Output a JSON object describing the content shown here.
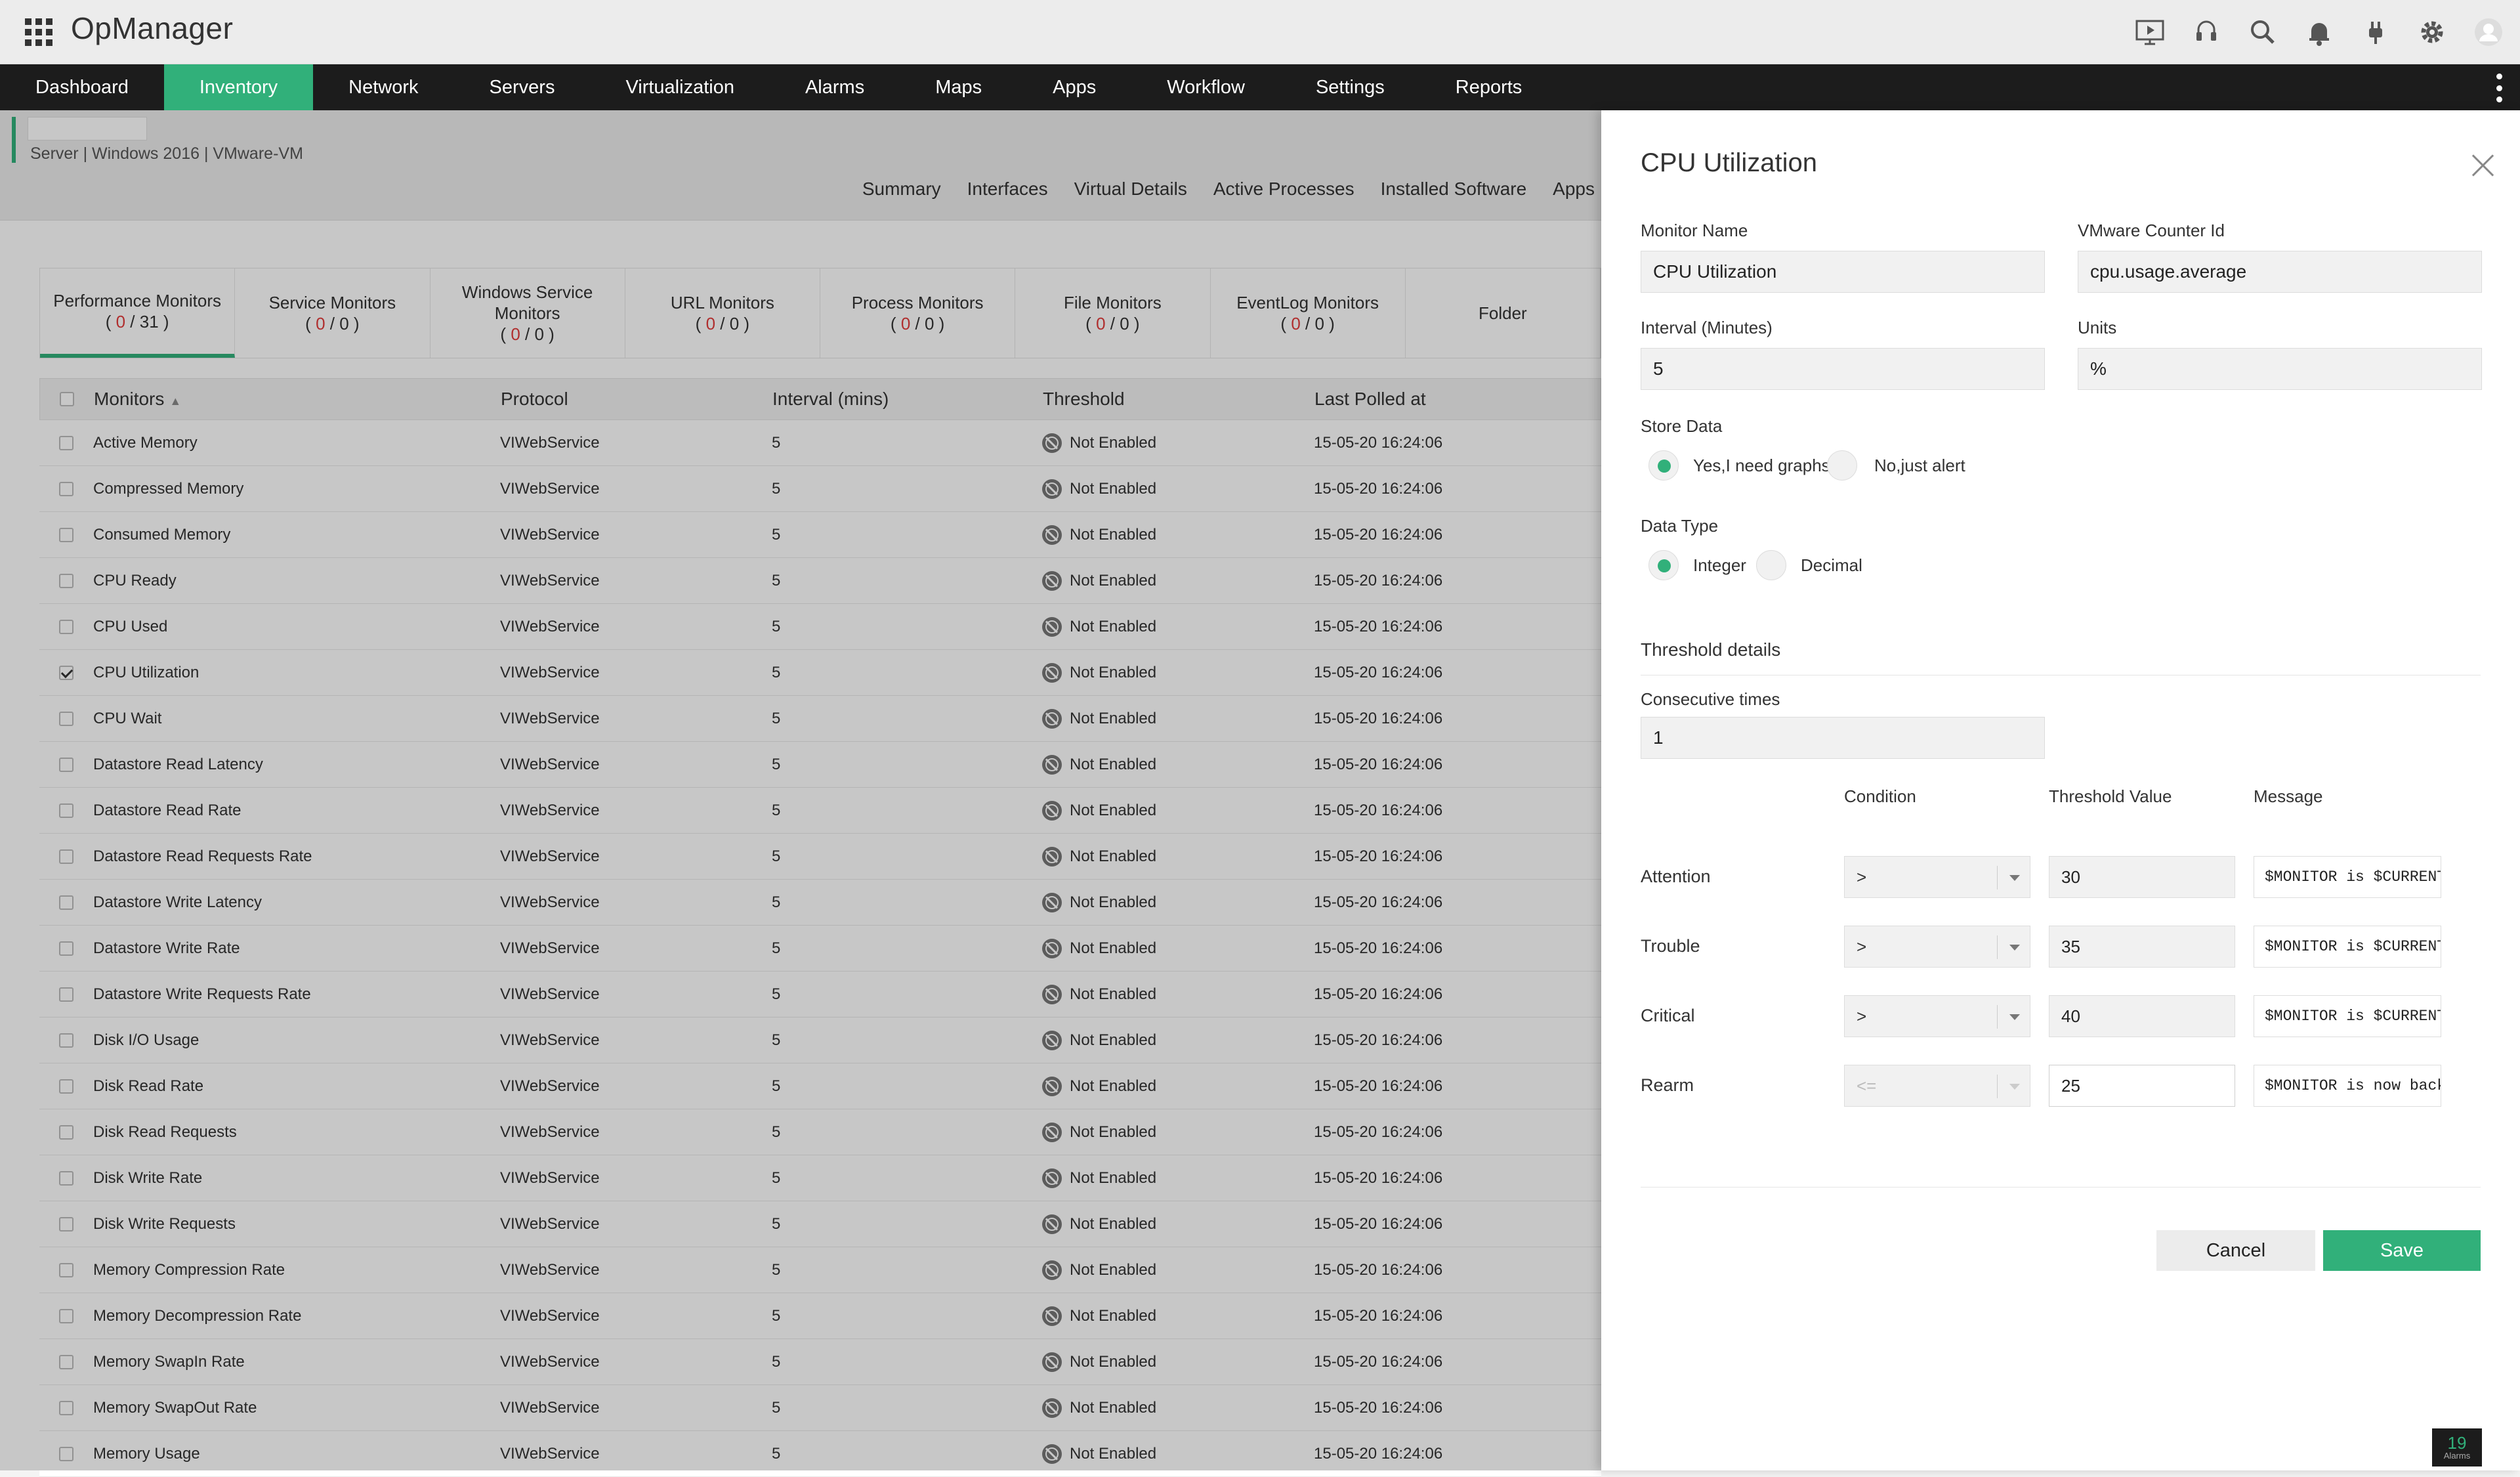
{
  "header": {
    "brand": "OpManager",
    "icons": [
      "presentation-icon",
      "support-headset-icon",
      "search-icon",
      "notification-bell-icon",
      "plug-icon",
      "settings-gear-icon",
      "user-avatar-icon"
    ]
  },
  "nav": {
    "items": [
      "Dashboard",
      "Inventory",
      "Network",
      "Servers",
      "Virtualization",
      "Alarms",
      "Maps",
      "Apps",
      "Workflow",
      "Settings",
      "Reports"
    ],
    "active": "Inventory"
  },
  "device": {
    "meta": "Server | Windows 2016  | VMware-VM",
    "tabs": [
      "Summary",
      "Interfaces",
      "Virtual Details",
      "Active Processes",
      "Installed Software",
      "Apps"
    ]
  },
  "monitor_tabs": [
    {
      "label": "Performance Monitors",
      "a": "0",
      "b": "31"
    },
    {
      "label": "Service Monitors",
      "a": "0",
      "b": "0"
    },
    {
      "label": "Windows Service Monitors",
      "a": "0",
      "b": "0"
    },
    {
      "label": "URL Monitors",
      "a": "0",
      "b": "0"
    },
    {
      "label": "Process Monitors",
      "a": "0",
      "b": "0"
    },
    {
      "label": "File Monitors",
      "a": "0",
      "b": "0"
    },
    {
      "label": "EventLog Monitors",
      "a": "0",
      "b": "0"
    },
    {
      "label": "Folder",
      "a": "",
      "b": ""
    }
  ],
  "table": {
    "columns": [
      "Monitors",
      "Protocol",
      "Interval (mins)",
      "Threshold",
      "Last Polled at"
    ],
    "rows": [
      {
        "name": "Active Memory",
        "protocol": "VIWebService",
        "interval": "5",
        "threshold": "Not Enabled",
        "last": "15-05-20 16:24:06",
        "checked": false
      },
      {
        "name": "Compressed Memory",
        "protocol": "VIWebService",
        "interval": "5",
        "threshold": "Not Enabled",
        "last": "15-05-20 16:24:06",
        "checked": false
      },
      {
        "name": "Consumed Memory",
        "protocol": "VIWebService",
        "interval": "5",
        "threshold": "Not Enabled",
        "last": "15-05-20 16:24:06",
        "checked": false
      },
      {
        "name": "CPU Ready",
        "protocol": "VIWebService",
        "interval": "5",
        "threshold": "Not Enabled",
        "last": "15-05-20 16:24:06",
        "checked": false
      },
      {
        "name": "CPU Used",
        "protocol": "VIWebService",
        "interval": "5",
        "threshold": "Not Enabled",
        "last": "15-05-20 16:24:06",
        "checked": false
      },
      {
        "name": "CPU Utilization",
        "protocol": "VIWebService",
        "interval": "5",
        "threshold": "Not Enabled",
        "last": "15-05-20 16:24:06",
        "checked": true
      },
      {
        "name": "CPU Wait",
        "protocol": "VIWebService",
        "interval": "5",
        "threshold": "Not Enabled",
        "last": "15-05-20 16:24:06",
        "checked": false
      },
      {
        "name": "Datastore Read Latency",
        "protocol": "VIWebService",
        "interval": "5",
        "threshold": "Not Enabled",
        "last": "15-05-20 16:24:06",
        "checked": false
      },
      {
        "name": "Datastore Read Rate",
        "protocol": "VIWebService",
        "interval": "5",
        "threshold": "Not Enabled",
        "last": "15-05-20 16:24:06",
        "checked": false
      },
      {
        "name": "Datastore Read Requests Rate",
        "protocol": "VIWebService",
        "interval": "5",
        "threshold": "Not Enabled",
        "last": "15-05-20 16:24:06",
        "checked": false
      },
      {
        "name": "Datastore Write Latency",
        "protocol": "VIWebService",
        "interval": "5",
        "threshold": "Not Enabled",
        "last": "15-05-20 16:24:06",
        "checked": false
      },
      {
        "name": "Datastore Write Rate",
        "protocol": "VIWebService",
        "interval": "5",
        "threshold": "Not Enabled",
        "last": "15-05-20 16:24:06",
        "checked": false
      },
      {
        "name": "Datastore Write Requests Rate",
        "protocol": "VIWebService",
        "interval": "5",
        "threshold": "Not Enabled",
        "last": "15-05-20 16:24:06",
        "checked": false
      },
      {
        "name": "Disk I/O Usage",
        "protocol": "VIWebService",
        "interval": "5",
        "threshold": "Not Enabled",
        "last": "15-05-20 16:24:06",
        "checked": false
      },
      {
        "name": "Disk Read Rate",
        "protocol": "VIWebService",
        "interval": "5",
        "threshold": "Not Enabled",
        "last": "15-05-20 16:24:06",
        "checked": false
      },
      {
        "name": "Disk Read Requests",
        "protocol": "VIWebService",
        "interval": "5",
        "threshold": "Not Enabled",
        "last": "15-05-20 16:24:06",
        "checked": false
      },
      {
        "name": "Disk Write Rate",
        "protocol": "VIWebService",
        "interval": "5",
        "threshold": "Not Enabled",
        "last": "15-05-20 16:24:06",
        "checked": false
      },
      {
        "name": "Disk Write Requests",
        "protocol": "VIWebService",
        "interval": "5",
        "threshold": "Not Enabled",
        "last": "15-05-20 16:24:06",
        "checked": false
      },
      {
        "name": "Memory Compression Rate",
        "protocol": "VIWebService",
        "interval": "5",
        "threshold": "Not Enabled",
        "last": "15-05-20 16:24:06",
        "checked": false
      },
      {
        "name": "Memory Decompression Rate",
        "protocol": "VIWebService",
        "interval": "5",
        "threshold": "Not Enabled",
        "last": "15-05-20 16:24:06",
        "checked": false
      },
      {
        "name": "Memory SwapIn Rate",
        "protocol": "VIWebService",
        "interval": "5",
        "threshold": "Not Enabled",
        "last": "15-05-20 16:24:06",
        "checked": false
      },
      {
        "name": "Memory SwapOut Rate",
        "protocol": "VIWebService",
        "interval": "5",
        "threshold": "Not Enabled",
        "last": "15-05-20 16:24:06",
        "checked": false
      },
      {
        "name": "Memory Usage",
        "protocol": "VIWebService",
        "interval": "5",
        "threshold": "Not Enabled",
        "last": "15-05-20 16:24:06",
        "checked": false
      }
    ]
  },
  "panel": {
    "title": "CPU Utilization",
    "monitor_name_label": "Monitor Name",
    "monitor_name": "CPU Utilization",
    "counter_label": "VMware Counter Id",
    "counter": "cpu.usage.average",
    "interval_label": "Interval (Minutes)",
    "interval": "5",
    "units_label": "Units",
    "units": "%",
    "store_label": "Store Data",
    "store_yes": "Yes,I need graphs",
    "store_no": "No,just alert",
    "store_selected": "yes",
    "type_label": "Data Type",
    "type_int": "Integer",
    "type_dec": "Decimal",
    "type_selected": "integer",
    "threshold_heading": "Threshold details",
    "consec_label": "Consecutive times",
    "consec": "1",
    "col_condition": "Condition",
    "col_value": "Threshold Value",
    "col_message": "Message",
    "rows": [
      {
        "label": "Attention",
        "condition": ">",
        "value": "30",
        "message": "$MONITOR is $CURRENT",
        "disabled": false
      },
      {
        "label": "Trouble",
        "condition": ">",
        "value": "35",
        "message": "$MONITOR is $CURRENT",
        "disabled": false
      },
      {
        "label": "Critical",
        "condition": ">",
        "value": "40",
        "message": "$MONITOR is $CURRENT",
        "disabled": false
      },
      {
        "label": "Rearm",
        "condition": "<=",
        "value": "25",
        "message": "$MONITOR is now back to normal",
        "disabled": true
      }
    ],
    "cancel": "Cancel",
    "save": "Save"
  },
  "alarms": {
    "count": "19",
    "label": "Alarms"
  },
  "colors": {
    "accent": "#31b07a",
    "nav_bg": "#1c1c1c",
    "alert_red": "#e23b3b"
  }
}
